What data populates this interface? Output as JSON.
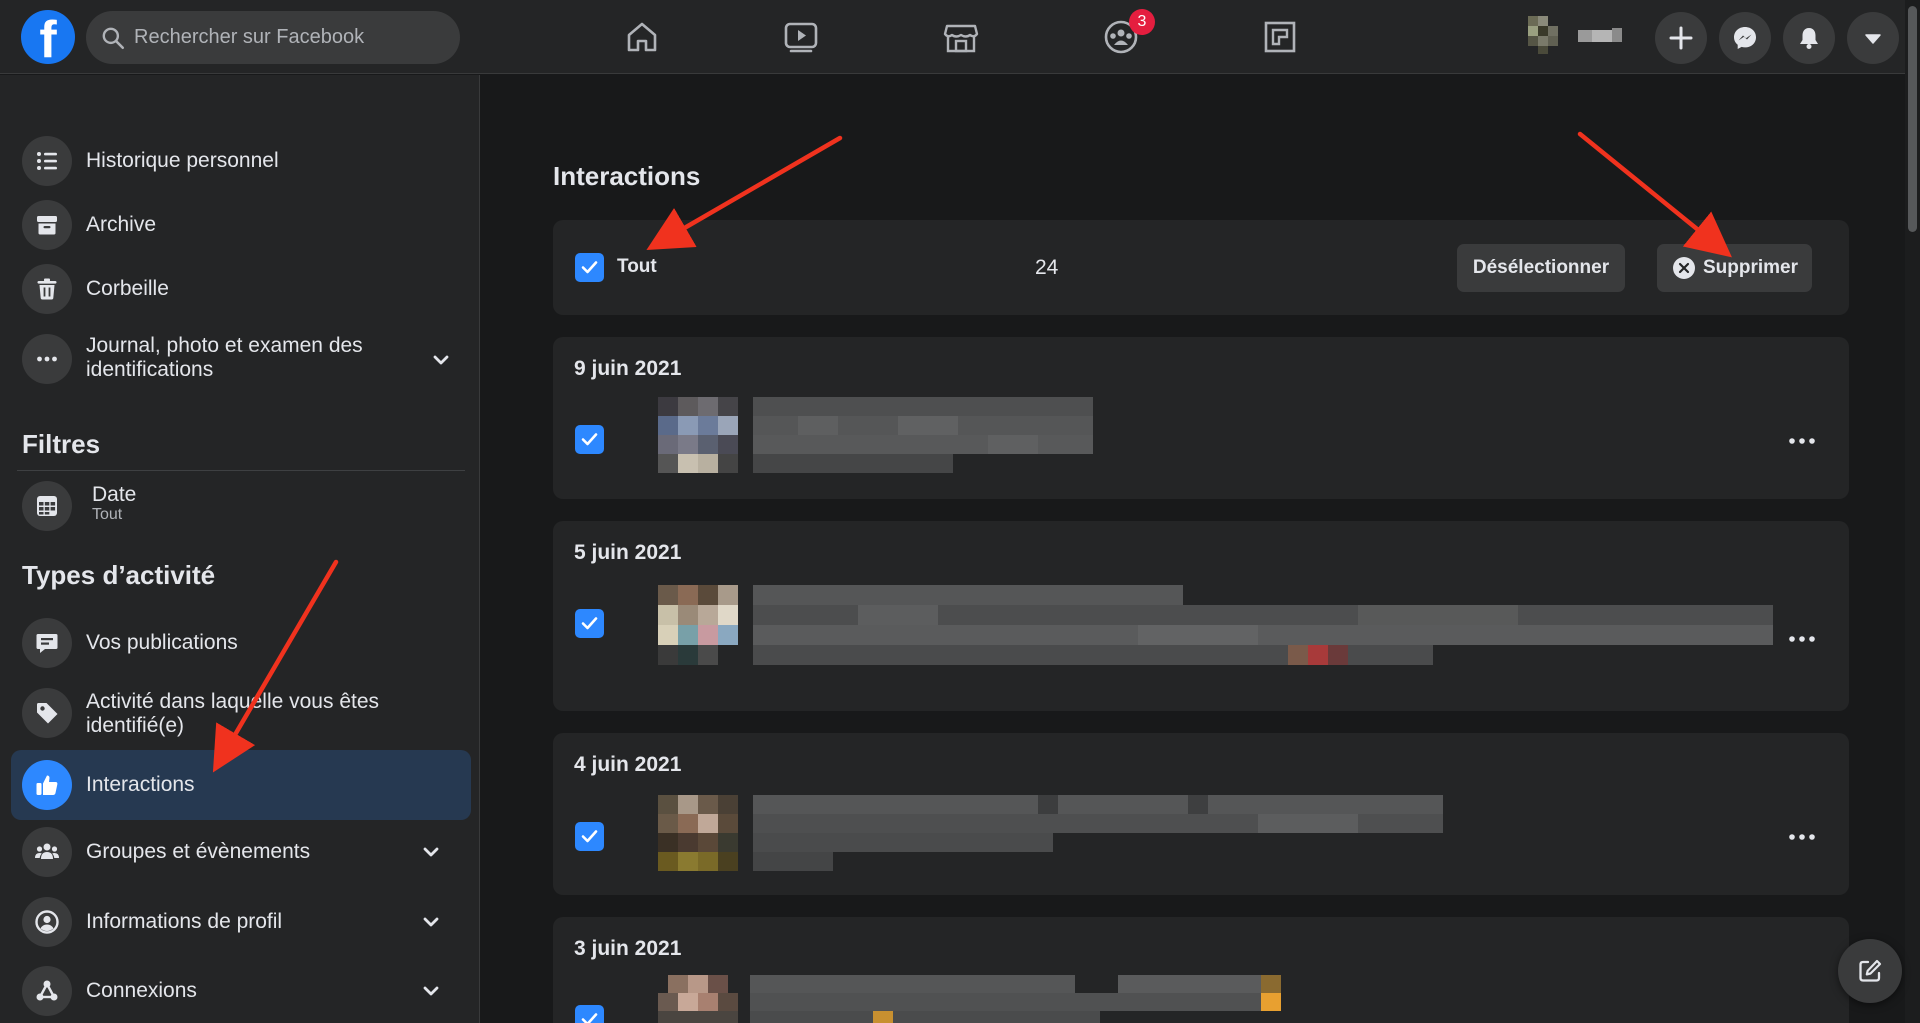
{
  "topbar": {
    "logo_letter": "f",
    "search_placeholder": "Rechercher sur Facebook",
    "nav_icons": [
      "home-icon",
      "watch-icon",
      "marketplace-icon",
      "groups-icon",
      "gaming-icon"
    ],
    "groups_badge": "3",
    "action_icons": [
      "plus-icon",
      "messenger-icon",
      "bell-icon",
      "caret-down-icon"
    ]
  },
  "sidebar": {
    "items": [
      {
        "label": "Historique personnel",
        "icon": "list-icon"
      },
      {
        "label": "Archive",
        "icon": "archive-icon"
      },
      {
        "label": "Corbeille",
        "icon": "trash-icon"
      },
      {
        "label_line1": "Journal, photo et examen des",
        "label_line2": "identifications",
        "icon": "more-icon"
      }
    ],
    "filters_title": "Filtres",
    "date_filter": {
      "label": "Date",
      "value": "Tout",
      "icon": "calendar-icon"
    },
    "types_title": "Types d’activité",
    "types": [
      {
        "label": "Vos publications",
        "icon": "post-icon"
      },
      {
        "label_line1": "Activité dans laquelle vous êtes",
        "label_line2": "identifié(e)",
        "icon": "tag-icon"
      },
      {
        "label": "Interactions",
        "icon": "thumbs-up-icon",
        "active": true
      },
      {
        "label": "Groupes et évènements",
        "icon": "groups-icon"
      },
      {
        "label": "Informations de profil",
        "icon": "profile-icon"
      },
      {
        "label": "Connexions",
        "icon": "connections-icon"
      }
    ]
  },
  "main": {
    "title": "Interactions",
    "select_all_label": "Tout",
    "selected_count": "24",
    "deselect_label": "Désélectionner",
    "delete_label": "Supprimer",
    "entries": [
      {
        "date": "9 juin 2021",
        "checked": true
      },
      {
        "date": "5 juin 2021",
        "checked": true
      },
      {
        "date": "4 juin 2021",
        "checked": true
      },
      {
        "date": "3 juin 2021",
        "checked": true
      }
    ]
  },
  "colors": {
    "accent": "#2d88ff",
    "facebook_blue": "#1877f2",
    "badge_red": "#e41e3f",
    "annotation_arrow": "#f0321e"
  }
}
